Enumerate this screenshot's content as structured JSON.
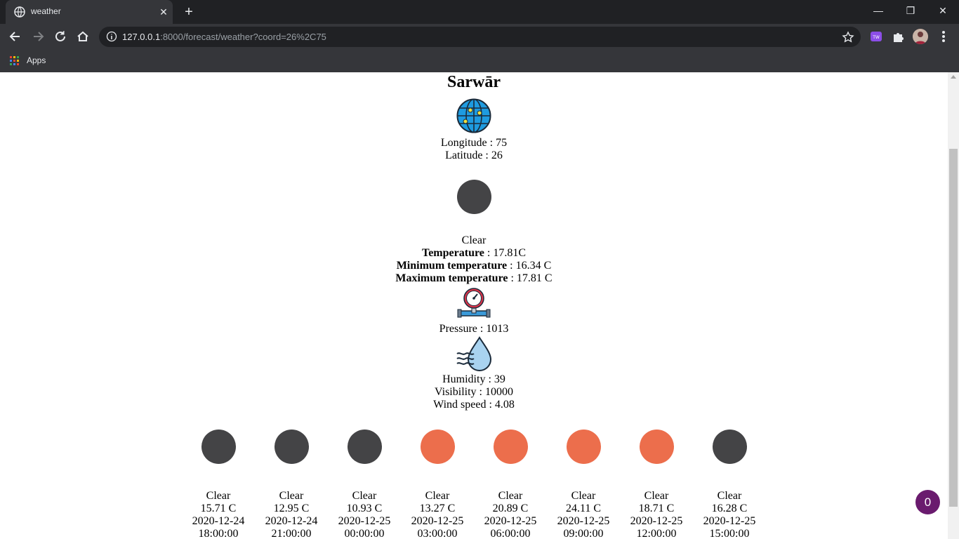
{
  "browser": {
    "tab_title": "weather",
    "url_host": "127.0.0.1",
    "url_rest": ":8000/forecast/weather?coord=26%2C75",
    "bookmarks": [
      {
        "label": "Apps"
      }
    ]
  },
  "location": {
    "city": "Sarwār",
    "longitude_label": "Longitude : 75",
    "latitude_label": "Latitude : 26"
  },
  "current": {
    "condition": "Clear",
    "temperature_label": "Temperature",
    "temperature_value": " : 17.81C",
    "min_label": "Minimum temperature",
    "min_value": " : 16.34 C",
    "max_label": "Maximum temperature",
    "max_value": " : 17.81 C",
    "pressure": "Pressure : 1013",
    "humidity": "Humidity : 39",
    "visibility": "Visibility : 10000",
    "wind": "Wind speed : 4.08",
    "icon_color": "#444446"
  },
  "forecast": [
    {
      "condition": "Clear",
      "temp": "15.71 C",
      "date": "2020-12-24",
      "time": "18:00:00",
      "color": "#444446"
    },
    {
      "condition": "Clear",
      "temp": "12.95 C",
      "date": "2020-12-24",
      "time": "21:00:00",
      "color": "#444446"
    },
    {
      "condition": "Clear",
      "temp": "10.93 C",
      "date": "2020-12-25",
      "time": "00:00:00",
      "color": "#444446"
    },
    {
      "condition": "Clear",
      "temp": "13.27 C",
      "date": "2020-12-25",
      "time": "03:00:00",
      "color": "#ec6e4c"
    },
    {
      "condition": "Clear",
      "temp": "20.89 C",
      "date": "2020-12-25",
      "time": "06:00:00",
      "color": "#ec6e4c"
    },
    {
      "condition": "Clear",
      "temp": "24.11 C",
      "date": "2020-12-25",
      "time": "09:00:00",
      "color": "#ec6e4c"
    },
    {
      "condition": "Clear",
      "temp": "18.71 C",
      "date": "2020-12-25",
      "time": "12:00:00",
      "color": "#ec6e4c"
    },
    {
      "condition": "Clear",
      "temp": "16.28 C",
      "date": "2020-12-25",
      "time": "15:00:00",
      "color": "#444446"
    }
  ],
  "fab": {
    "label": "0"
  },
  "colors": {
    "chrome_dark": "#202124",
    "chrome_mid": "#35363a",
    "night": "#444446",
    "day": "#ec6e4c",
    "fab": "#6a1b6e"
  }
}
